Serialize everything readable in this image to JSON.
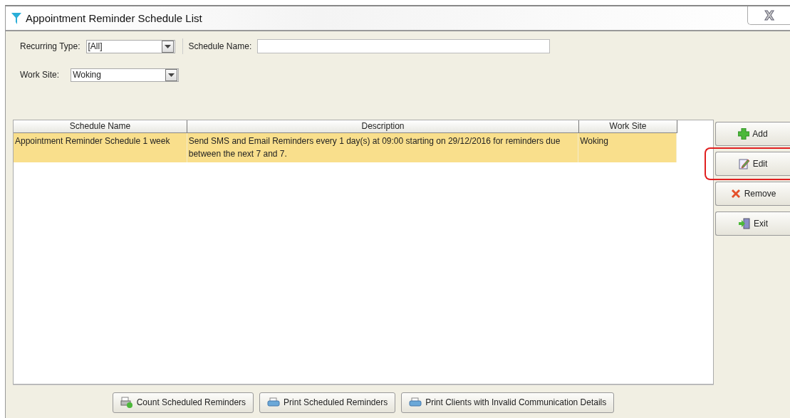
{
  "window": {
    "title": "Appointment Reminder Schedule List",
    "close": "X"
  },
  "filters": {
    "recurring_type": {
      "label": "Recurring Type:",
      "value": "[All]"
    },
    "schedule_name": {
      "label": "Schedule Name:"
    },
    "work_site": {
      "label": "Work Site:",
      "value": "Woking"
    }
  },
  "table": {
    "columns": [
      "Schedule Name",
      "Description",
      "Work Site"
    ],
    "rows": [
      {
        "selected": true,
        "cells": [
          "Appointment Reminder Schedule 1 week",
          "Send SMS and Email Reminders every 1 day(s) at 09:00 starting on 29/12/2016 for reminders due between the next 7 and 7.",
          "Woking"
        ]
      }
    ]
  },
  "side_buttons": [
    {
      "kind": "add",
      "label": "Add",
      "highlighted": false
    },
    {
      "kind": "edit",
      "label": "Edit",
      "highlighted": true
    },
    {
      "kind": "remove",
      "label": "Remove",
      "highlighted": false
    },
    {
      "kind": "exit",
      "label": "Exit",
      "highlighted": false
    }
  ],
  "bottom_buttons": [
    {
      "kind": "count",
      "label": "Count Scheduled Reminders"
    },
    {
      "kind": "print",
      "label": "Print Scheduled Reminders"
    },
    {
      "kind": "print",
      "label": "Print Clients with Invalid Communication Details"
    }
  ]
}
